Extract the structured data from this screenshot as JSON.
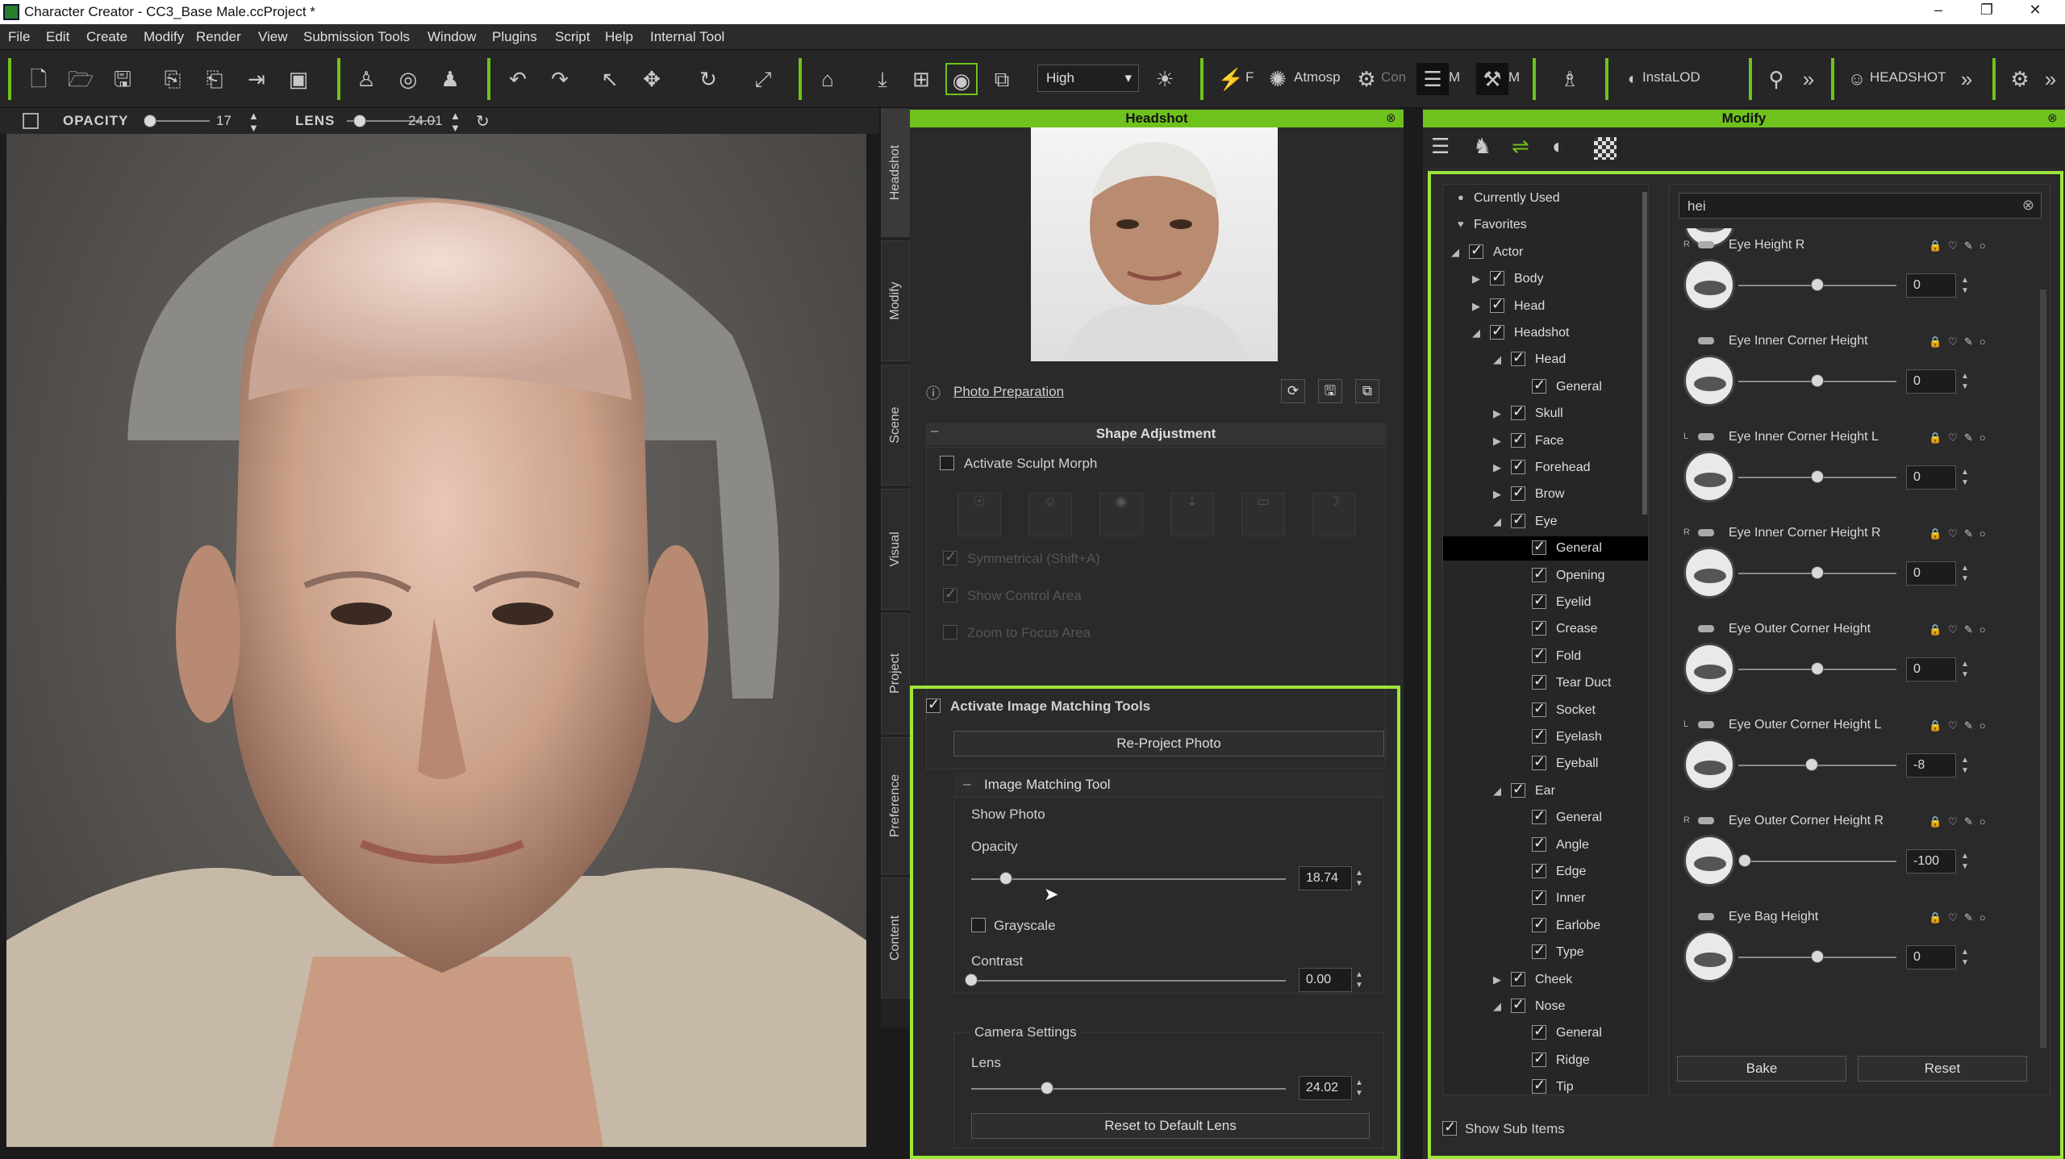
{
  "window": {
    "title": "Character Creator - CC3_Base Male.ccProject *"
  },
  "menu": [
    "File",
    "Edit",
    "Create",
    "Modify",
    "Render",
    "View",
    "Submission Tools",
    "Window",
    "Plugins",
    "Script",
    "Help",
    "Internal Tool"
  ],
  "toolbar": {
    "quality": "High",
    "f_label": "F",
    "atmos_label": "Atmosp",
    "con_label": "Con",
    "m_label": "M",
    "m2_label": "M",
    "instalod_label": "InstaLOD",
    "headshot_label": "HEADSHOT"
  },
  "options": {
    "opacity_label": "OPACITY",
    "opacity_value": "17",
    "lens_label": "LENS",
    "lens_value": "24.01"
  },
  "side_tabs": [
    "Headshot",
    "Modify",
    "Scene",
    "Visual",
    "Project",
    "Preference",
    "Content"
  ],
  "headshot": {
    "title": "Headshot",
    "photo_prep": "Photo Preparation",
    "shape_adjustment": "Shape Adjustment",
    "activate_sculpt": "Activate Sculpt Morph",
    "symmetrical": "Symmetrical (Shift+A)",
    "show_control": "Show Control Area",
    "zoom_focus": "Zoom to Focus Area",
    "activate_imt": "Activate Image Matching Tools",
    "reproject": "Re-Project Photo",
    "imt_section": "Image Matching Tool",
    "show_photo": "Show Photo",
    "opacity_label": "Opacity",
    "opacity_value": "18.74",
    "opacity_level": 0.11,
    "grayscale": "Grayscale",
    "contrast_label": "Contrast",
    "contrast_value": "0.00",
    "contrast_level": 0.0,
    "camera_settings": "Camera Settings",
    "lens_label": "Lens",
    "lens_value": "24.02",
    "lens_level": 0.24,
    "reset_lens": "Reset to Default Lens"
  },
  "modify": {
    "title": "Modify",
    "search": "hei",
    "show_sub_items": "Show Sub Items",
    "bake": "Bake",
    "reset": "Reset",
    "tree": [
      {
        "label": "Currently Used",
        "indent": 0,
        "kind": "dot"
      },
      {
        "label": "Favorites",
        "indent": 0,
        "kind": "heart"
      },
      {
        "label": "Actor",
        "indent": 0,
        "kind": "open"
      },
      {
        "label": "Body",
        "indent": 1,
        "kind": "closed"
      },
      {
        "label": "Head",
        "indent": 1,
        "kind": "closed"
      },
      {
        "label": "Headshot",
        "indent": 1,
        "kind": "open"
      },
      {
        "label": "Head",
        "indent": 2,
        "kind": "open"
      },
      {
        "label": "General",
        "indent": 3,
        "kind": "leaf"
      },
      {
        "label": "Skull",
        "indent": 2,
        "kind": "closed"
      },
      {
        "label": "Face",
        "indent": 2,
        "kind": "closed"
      },
      {
        "label": "Forehead",
        "indent": 2,
        "kind": "closed"
      },
      {
        "label": "Brow",
        "indent": 2,
        "kind": "closed"
      },
      {
        "label": "Eye",
        "indent": 2,
        "kind": "open"
      },
      {
        "label": "General",
        "indent": 3,
        "kind": "leaf",
        "selected": true
      },
      {
        "label": "Opening",
        "indent": 3,
        "kind": "leaf"
      },
      {
        "label": "Eyelid",
        "indent": 3,
        "kind": "leaf"
      },
      {
        "label": "Crease",
        "indent": 3,
        "kind": "leaf"
      },
      {
        "label": "Fold",
        "indent": 3,
        "kind": "leaf"
      },
      {
        "label": "Tear Duct",
        "indent": 3,
        "kind": "leaf"
      },
      {
        "label": "Socket",
        "indent": 3,
        "kind": "leaf"
      },
      {
        "label": "Eyelash",
        "indent": 3,
        "kind": "leaf"
      },
      {
        "label": "Eyeball",
        "indent": 3,
        "kind": "leaf"
      },
      {
        "label": "Ear",
        "indent": 2,
        "kind": "open"
      },
      {
        "label": "General",
        "indent": 3,
        "kind": "leaf"
      },
      {
        "label": "Angle",
        "indent": 3,
        "kind": "leaf"
      },
      {
        "label": "Edge",
        "indent": 3,
        "kind": "leaf"
      },
      {
        "label": "Inner",
        "indent": 3,
        "kind": "leaf"
      },
      {
        "label": "Earlobe",
        "indent": 3,
        "kind": "leaf"
      },
      {
        "label": "Type",
        "indent": 3,
        "kind": "leaf"
      },
      {
        "label": "Cheek",
        "indent": 2,
        "kind": "closed"
      },
      {
        "label": "Nose",
        "indent": 2,
        "kind": "open"
      },
      {
        "label": "General",
        "indent": 3,
        "kind": "leaf"
      },
      {
        "label": "Ridge",
        "indent": 3,
        "kind": "leaf"
      },
      {
        "label": "Tip",
        "indent": 3,
        "kind": "leaf"
      }
    ],
    "morphs": [
      {
        "name": "Eye Height R",
        "side": "R",
        "value": "0",
        "level": 0.5
      },
      {
        "name": "Eye Inner Corner Height",
        "side": "",
        "value": "0",
        "level": 0.5
      },
      {
        "name": "Eye Inner Corner Height L",
        "side": "L",
        "value": "0",
        "level": 0.5
      },
      {
        "name": "Eye Inner Corner Height R",
        "side": "R",
        "value": "0",
        "level": 0.5
      },
      {
        "name": "Eye Outer Corner Height",
        "side": "",
        "value": "0",
        "level": 0.5
      },
      {
        "name": "Eye Outer Corner Height L",
        "side": "L",
        "value": "-8",
        "level": 0.46
      },
      {
        "name": "Eye Outer Corner Height R",
        "side": "R",
        "value": "-100",
        "level": 0.0
      },
      {
        "name": "Eye Bag Height",
        "side": "",
        "value": "0",
        "level": 0.5
      }
    ]
  },
  "colors": {
    "accent": "#6fc21d",
    "highlight": "#9ee53a"
  }
}
